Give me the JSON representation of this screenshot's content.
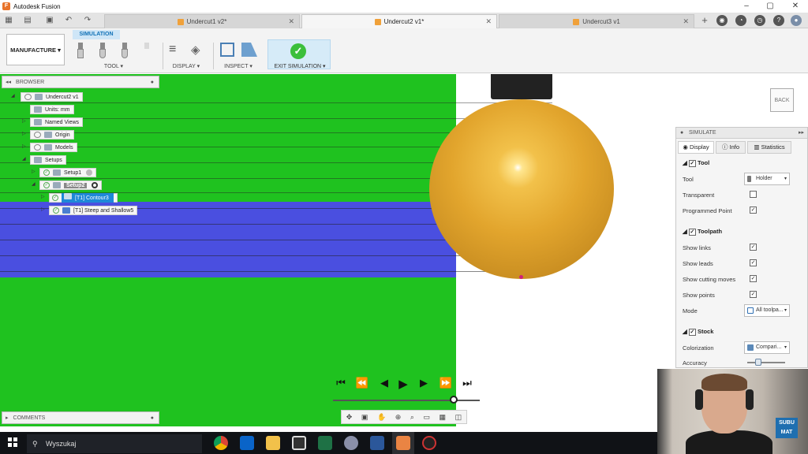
{
  "app": {
    "title": "Autodesk Fusion",
    "logo_letter": "F"
  },
  "tabs": [
    {
      "label": "Undercut1 v2*",
      "active": false
    },
    {
      "label": "Undercut2 v1*",
      "active": true
    },
    {
      "label": "Undercut3 v1",
      "active": false
    }
  ],
  "toolbar": {
    "workspace": "MANUFACTURE ▾",
    "context_tab": "SIMULATION",
    "tool_label": "TOOL ▾",
    "display_label": "DISPLAY ▾",
    "inspect_label": "INSPECT ▾",
    "exit_label": "EXIT SIMULATION ▾"
  },
  "browser": {
    "title": "BROWSER",
    "nodes": [
      {
        "label": "Undercut2 v1"
      },
      {
        "label": "Units: mm"
      },
      {
        "label": "Named Views"
      },
      {
        "label": "Origin"
      },
      {
        "label": "Models"
      },
      {
        "label": "Setups"
      },
      {
        "label": "Setup1"
      },
      {
        "label": "Setup2"
      },
      {
        "label": "[T1] Contour3"
      },
      {
        "label": "[T1] Steep and Shallow5"
      }
    ]
  },
  "viewcube": {
    "label": "BACK"
  },
  "simulate": {
    "title": "SIMULATE",
    "tabs": [
      "Display",
      "Info",
      "Statistics"
    ],
    "sections": {
      "tool": "Tool",
      "toolpath": "Toolpath",
      "stock": "Stock"
    },
    "rows": {
      "tool": "Tool",
      "transparent": "Transparent",
      "programmed_point": "Programmed Point",
      "show_links": "Show links",
      "show_leads": "Show leads",
      "show_cutting_moves": "Show cutting moves",
      "show_points": "Show points",
      "mode": "Mode",
      "colorization": "Colorization",
      "accuracy": "Accuracy"
    },
    "values": {
      "tool": "Holder",
      "mode": "All toolpa...",
      "colorization": "Compari...",
      "transparent": false,
      "programmed_point": true,
      "show_links": true,
      "show_leads": true,
      "show_cutting_moves": true,
      "show_points": true,
      "accuracy_fraction": 0.3
    }
  },
  "playback": {
    "progress_fraction": 0.82
  },
  "comments": {
    "title": "COMMENTS"
  },
  "taskbar": {
    "search_placeholder": "Wyszukaj"
  },
  "webcam": {
    "logo_line1": "SUBU",
    "logo_line2": "MAT"
  },
  "colors": {
    "stock_green": "#1fc21f",
    "band_blue": "#4a4fe0",
    "ball": "#e2a52d",
    "accent": "#1e88d8"
  }
}
